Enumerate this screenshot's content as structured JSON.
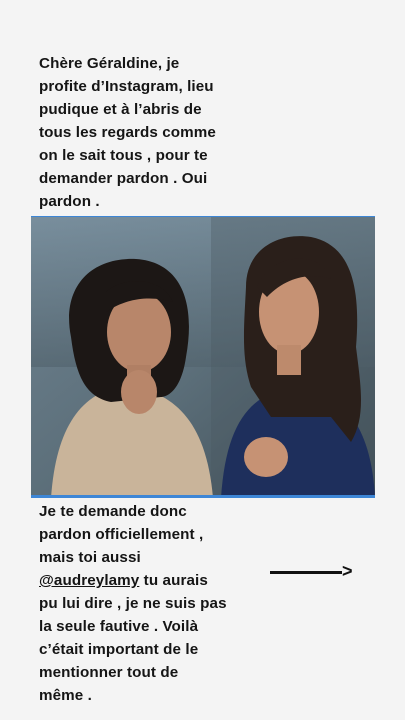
{
  "story": {
    "top_text": [
      "Chère Géraldine, je",
      "profite d’Instagram, lieu",
      "pudique et à l’abris de",
      "tous les regards comme",
      "on le sait tous , pour te",
      "demander pardon . Oui",
      "pardon ."
    ],
    "bottom_text": {
      "line1": "Je te demande donc",
      "line2": "pardon officiellement ,",
      "line3": "mais toi aussi",
      "mention": "@audreylamy",
      "line4_rest": " tu aurais",
      "line5": "pu lui dire , je ne suis pas",
      "line6": "la seule fautive . Voilà",
      "line7": "c’était important de le",
      "line8": "mentionner tout de",
      "line9": "même ."
    },
    "arrow_head": ">",
    "colors": {
      "background": "#f4f4f4",
      "accent_blue": "#3d86d6",
      "text": "#151515"
    }
  }
}
